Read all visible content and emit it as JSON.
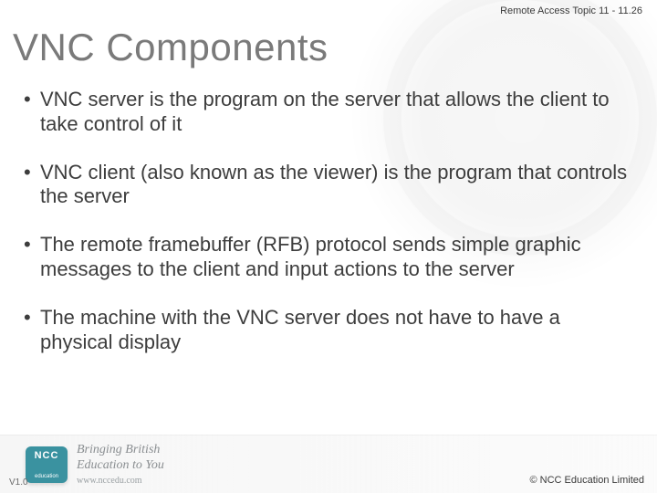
{
  "header": {
    "meta": "Remote Access  Topic 11 - 11.26"
  },
  "title": "VNC Components",
  "bullets": [
    "VNC server is the program on the server that allows the client to take control of it",
    "VNC client (also known as the viewer) is the program that controls the server",
    "The remote framebuffer (RFB) protocol sends simple graphic messages to the client and input actions to the server",
    "The machine with the VNC server does not have to have a physical display"
  ],
  "footer": {
    "logo_name": "NCC education",
    "tagline_line1": "Bringing British",
    "tagline_line2": "Education to You",
    "site": "www.nccedu.com",
    "version": "V1.0",
    "copyright": "©  NCC Education Limited"
  }
}
